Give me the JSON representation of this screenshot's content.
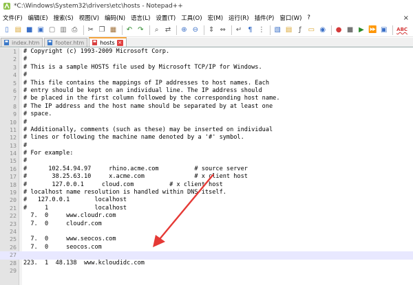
{
  "window": {
    "title": "*C:\\Windows\\System32\\drivers\\etc\\hosts - Notepad++",
    "close_glyph": "×"
  },
  "menu": [
    "文件(F)",
    "编辑(E)",
    "搜索(S)",
    "视图(V)",
    "编码(N)",
    "语言(L)",
    "设置(T)",
    "工具(O)",
    "宏(M)",
    "运行(R)",
    "插件(P)",
    "窗口(W)",
    "?"
  ],
  "toolbar": {
    "icons": [
      "new-file-icon",
      "open-file-icon",
      "save-icon",
      "save-all-icon",
      "close-icon",
      "close-all-icon",
      "print-icon",
      "cut-icon",
      "copy-icon",
      "paste-icon",
      "undo-icon",
      "redo-icon",
      "find-icon",
      "replace-icon",
      "zoom-in-icon",
      "zoom-out-icon",
      "sync-vertical-icon",
      "sync-horizontal-icon",
      "word-wrap-icon",
      "show-all-chars-icon",
      "indent-guide-icon",
      "user-lang-icon",
      "doc-map-icon",
      "function-list-icon",
      "folder-workspace-icon",
      "monitor-icon",
      "record-macro-icon",
      "stop-macro-icon",
      "play-macro-icon",
      "run-macro-multiple-icon",
      "save-macro-icon",
      "spellcheck-icon"
    ],
    "spellcheck_label": "ABC"
  },
  "tabs": [
    {
      "label": "index.htm",
      "active": false
    },
    {
      "label": "footer.htm",
      "active": false
    },
    {
      "label": "hosts",
      "active": true
    }
  ],
  "editor": {
    "current_line": 27,
    "lines": [
      {
        "n": "1",
        "text": "# Copyright (c) 1993-2009 Microsoft Corp."
      },
      {
        "n": "2",
        "text": "#"
      },
      {
        "n": "3",
        "text": "# This is a sample HOSTS file used by Microsoft TCP/IP for Windows."
      },
      {
        "n": "4",
        "text": "#"
      },
      {
        "n": "5",
        "text": "# This file contains the mappings of IP addresses to host names. Each"
      },
      {
        "n": "6",
        "text": "# entry should be kept on an individual line. The IP address should"
      },
      {
        "n": "7",
        "text": "# be placed in the first column followed by the corresponding host name."
      },
      {
        "n": "8",
        "text": "# The IP address and the host name should be separated by at least one"
      },
      {
        "n": "9",
        "text": "# space."
      },
      {
        "n": "10",
        "text": "#"
      },
      {
        "n": "11",
        "text": "# Additionally, comments (such as these) may be inserted on individual"
      },
      {
        "n": "12",
        "text": "# lines or following the machine name denoted by a '#' symbol."
      },
      {
        "n": "13",
        "text": "#"
      },
      {
        "n": "14",
        "text": "# For example:"
      },
      {
        "n": "15",
        "text": "#"
      },
      {
        "n": "16",
        "text": "#      102.54.94.97     rhino.acme.com          # source server"
      },
      {
        "n": "17",
        "text": "#       38.25.63.10     x.acme.com              # x client host"
      },
      {
        "n": "18",
        "text": "#       127.0.0.1     cloud.com          # x client host"
      },
      {
        "n": "19",
        "text": "# localhost name resolution is handled within DNS itself."
      },
      {
        "n": "20",
        "text": "#   127.0.0.1       localhost"
      },
      {
        "n": "21",
        "text": "#     1             localhost"
      },
      {
        "n": "22",
        "text": "  7.  0     www.cloudr.com"
      },
      {
        "n": "23",
        "text": "  7.  0     cloudr.com"
      },
      {
        "n": "24",
        "text": ""
      },
      {
        "n": "25",
        "text": "  7.  0     www.seocos.com"
      },
      {
        "n": "26",
        "text": "  7.  0     seocos.com"
      },
      {
        "n": "27",
        "text": ""
      },
      {
        "n": "28",
        "text": "223.  1  48.138  www.kcloudidc.com"
      },
      {
        "n": "29",
        "text": ""
      }
    ]
  },
  "colors": {
    "annotation_arrow": "#e53935",
    "active_tab_accent": "#f5a33a",
    "current_line_bg": "#e8e8ff"
  }
}
